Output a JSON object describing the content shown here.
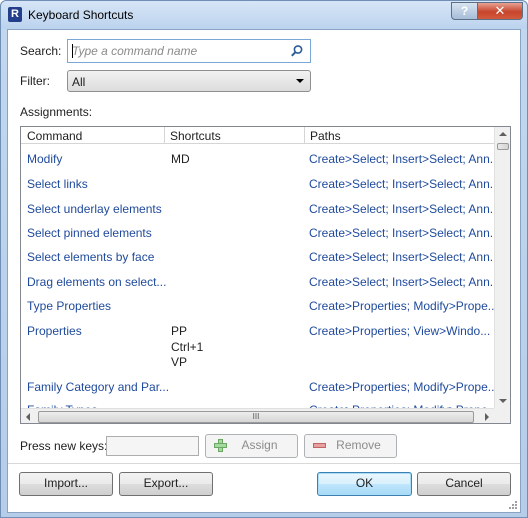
{
  "window": {
    "title": "Keyboard Shortcuts",
    "help_label": "?",
    "close_label": "✕"
  },
  "search": {
    "label": "Search:",
    "placeholder": "Type a command name",
    "value": ""
  },
  "filter": {
    "label": "Filter:",
    "selected": "All"
  },
  "assignments": {
    "label": "Assignments:",
    "columns": [
      "Command",
      "Shortcuts",
      "Paths"
    ],
    "rows": [
      {
        "command": "Modify",
        "shortcuts": "MD",
        "paths": "Create>Select; Insert>Select; Ann..."
      },
      {
        "command": "Select links",
        "shortcuts": "",
        "paths": "Create>Select; Insert>Select; Ann..."
      },
      {
        "command": "Select underlay elements",
        "shortcuts": "",
        "paths": "Create>Select; Insert>Select; Ann..."
      },
      {
        "command": "Select pinned elements",
        "shortcuts": "",
        "paths": "Create>Select; Insert>Select; Ann..."
      },
      {
        "command": "Select elements by face",
        "shortcuts": "",
        "paths": "Create>Select; Insert>Select; Ann..."
      },
      {
        "command": "Drag elements on select...",
        "shortcuts": "",
        "paths": "Create>Select; Insert>Select; Ann..."
      },
      {
        "command": "Type Properties",
        "shortcuts": "",
        "paths": "Create>Properties; Modify>Prope..."
      },
      {
        "command": "Properties",
        "shortcuts": "PP\nCtrl+1\nVP",
        "paths": "Create>Properties; View>Windo..."
      },
      {
        "command": "Family Category and Par...",
        "shortcuts": "",
        "paths": "Create>Properties; Modify>Prope..."
      },
      {
        "command": "Family Types",
        "shortcuts": "",
        "paths": "Create>Properties; Modify>Prope..."
      }
    ],
    "hscroll_grip": "III"
  },
  "keys": {
    "label": "Press new keys:",
    "value": "",
    "assign_label": "Assign",
    "remove_label": "Remove"
  },
  "buttons": {
    "import": "Import...",
    "export": "Export...",
    "ok": "OK",
    "cancel": "Cancel"
  },
  "colors": {
    "link": "#1f4a9c",
    "title_bar": "#c3d8ef",
    "close_button": "#c7452c"
  }
}
